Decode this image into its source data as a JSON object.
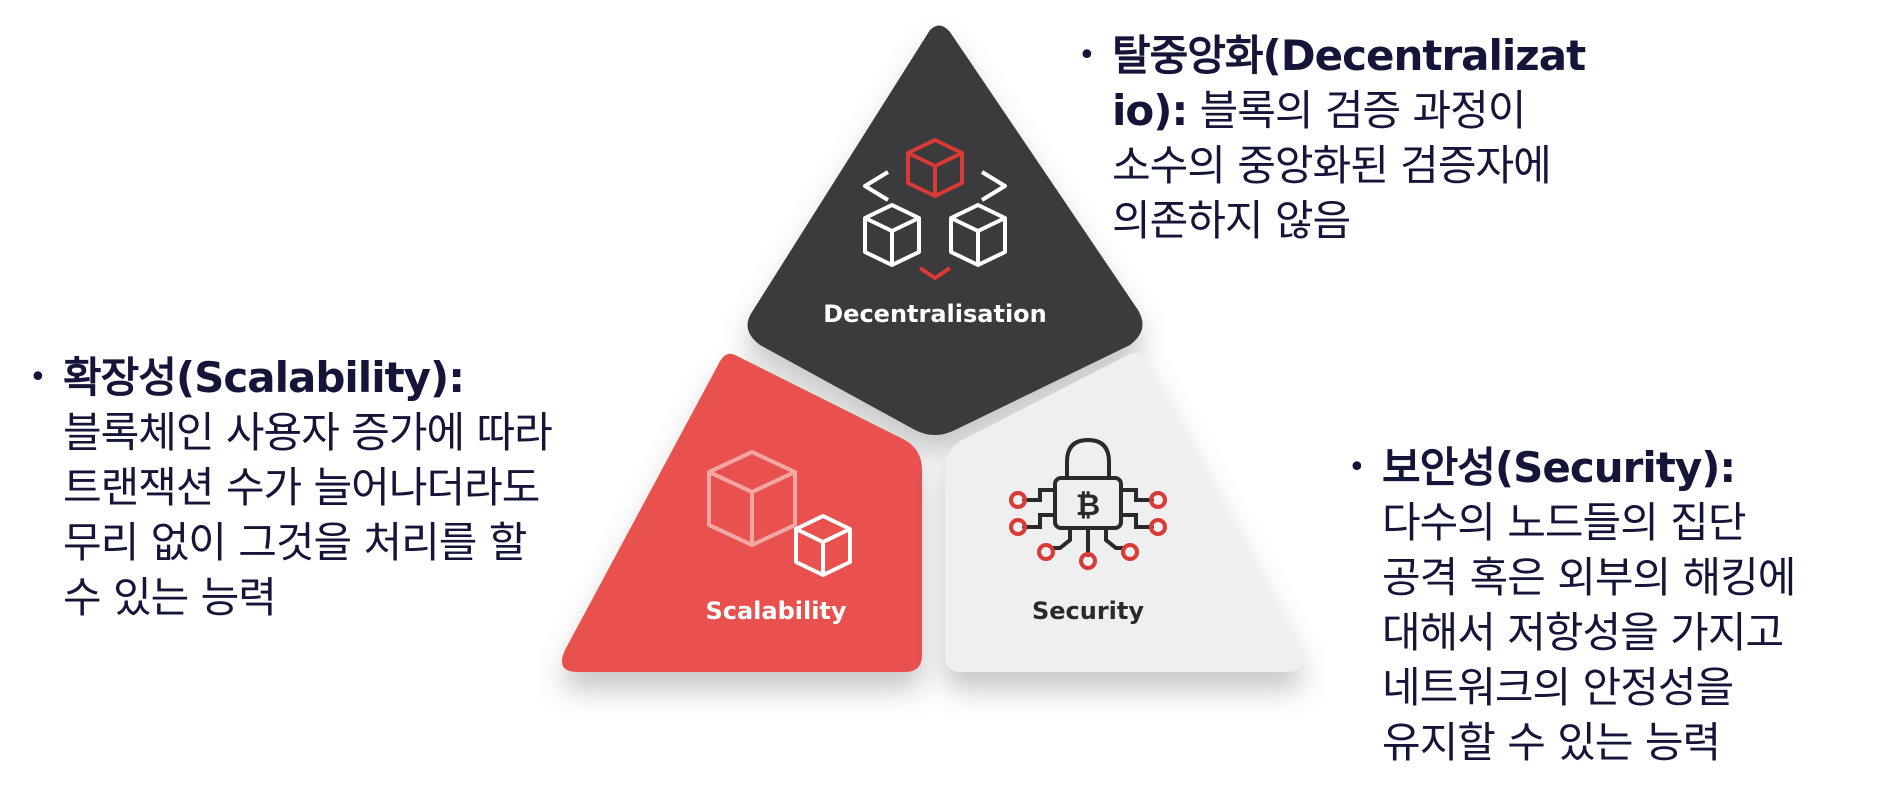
{
  "triangle_labels": {
    "top": "Decentralisation",
    "left": "Scalability",
    "right": "Security"
  },
  "icons": {
    "top": "network-cubes-icon",
    "left": "cubes-icon",
    "right": "bitcoin-padlock-icon"
  },
  "bitcoin_symbol": "₿",
  "notes": {
    "decentralization": {
      "title": "탈중앙화(Decentralizat",
      "title_cont": "io):",
      "line1": " 블록의 검증 과정이",
      "line2": "소수의 중앙화된 검증자에",
      "line3": "의존하지 않음"
    },
    "scalability": {
      "title": "확장성(Scalability):",
      "line1": "블록체인 사용자 증가에 따라",
      "line2": "트랜잭션 수가 늘어나더라도",
      "line3": "무리 없이 그것을 처리를 할",
      "line4": "수 있는 능력"
    },
    "security": {
      "title": "보안성(Security):",
      "line1": "다수의 노드들의 집단",
      "line2": "공격 혹은 외부의 해킹에",
      "line3": "대해서 저항성을 가지고",
      "line4": "네트워크의 안정성을",
      "line5": "유지할 수 있는 능력"
    }
  },
  "colors": {
    "dark": "#3b3b3d",
    "red": "#e8514e",
    "light": "#efefef",
    "text": "#15153a",
    "accent_red": "#d93a35"
  }
}
